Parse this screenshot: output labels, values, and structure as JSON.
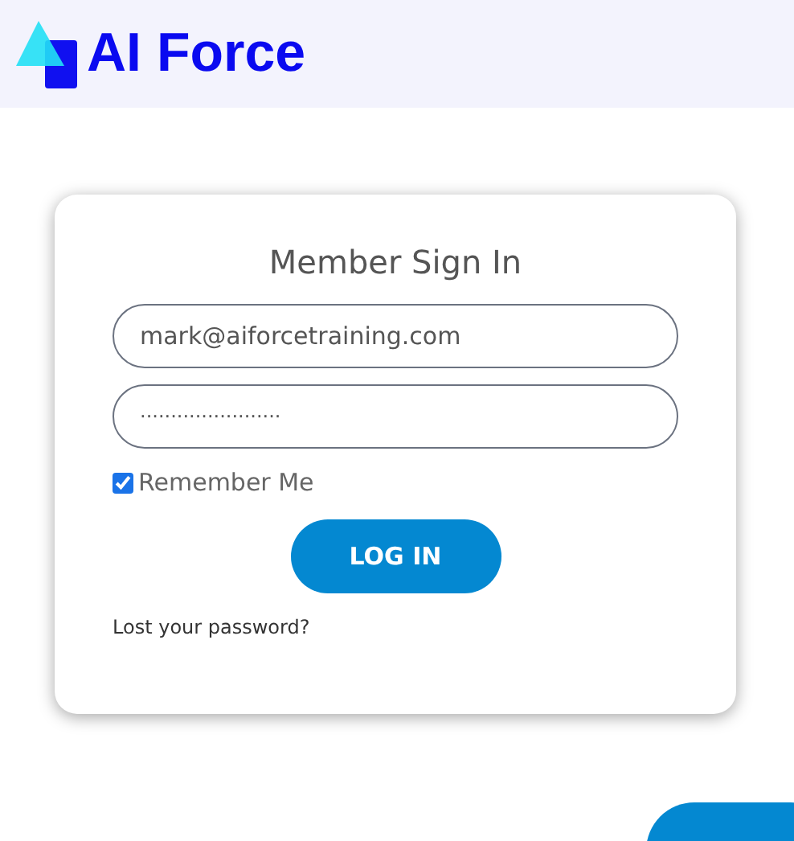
{
  "header": {
    "brand": "AI Force"
  },
  "signin": {
    "title": "Member Sign In",
    "email": {
      "value": "mark@aiforcetraining.com"
    },
    "password": {
      "value": "·······················"
    },
    "remember": {
      "label": "Remember Me",
      "checked": true
    },
    "button": "LOG IN",
    "lost_password": "Lost your password?"
  }
}
